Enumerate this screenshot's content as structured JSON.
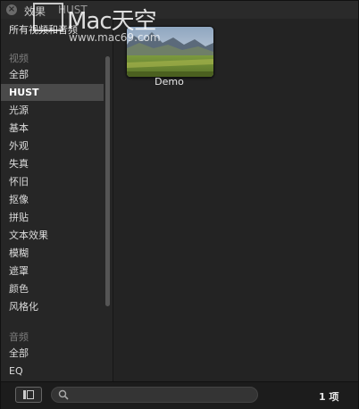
{
  "window": {
    "title": "效果",
    "subtitle": "HUST"
  },
  "sidebar": {
    "top_item": "所有视频和音频",
    "video_header": "视频",
    "video_items": [
      "全部",
      "HUST",
      "光源",
      "基本",
      "外观",
      "失真",
      "怀旧",
      "抠像",
      "拼贴",
      "文本效果",
      "模糊",
      "遮罩",
      "颜色",
      "风格化"
    ],
    "selected_item": "HUST",
    "audio_header": "音频",
    "audio_items": [
      "全部",
      "EQ"
    ]
  },
  "main": {
    "items": [
      {
        "label": "Demo",
        "icon": "landscape-thumbnail"
      }
    ]
  },
  "watermark": {
    "brand": "Mac天空",
    "url": "www.mac69.com"
  },
  "bottombar": {
    "search_placeholder": "",
    "count": "1 项"
  },
  "colors": {
    "background": "#262626",
    "selection": "#4a4a4a",
    "text": "#dcdcdc",
    "muted": "#7c7c7c"
  }
}
